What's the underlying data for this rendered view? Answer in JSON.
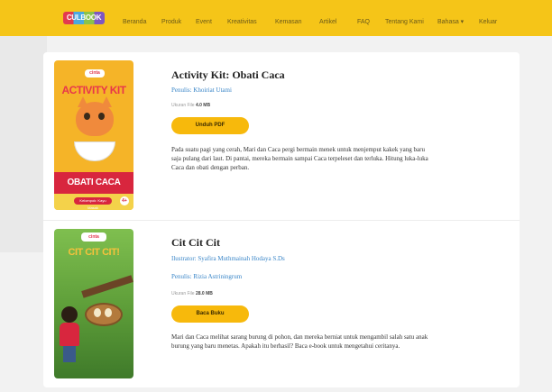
{
  "colors": {
    "nav_bg": "#f5c518",
    "accent_button": "#f7b90c",
    "link_blue": "#3a86c8",
    "page_bg": "#f2f2f2"
  },
  "nav": {
    "logo_text": "CULBOOK",
    "items": [
      "Beranda",
      "Produk",
      "Event",
      "Kreativitas",
      "Kemasan",
      "Artikel",
      "FAQ",
      "Tentang Kami",
      "Bahasa ▾",
      "Keluar"
    ]
  },
  "books": [
    {
      "title": "Activity Kit: Obati Caca",
      "author_line": "Penulis: Khoiriat Utami",
      "filesize_label": "Ukuran File",
      "filesize_value": "4.0 MB",
      "button_label": "Unduh PDF",
      "description": "Pada suatu pagi yang cerah, Mari dan Caca pergi bermain menek untuk menjemput kakek yang baru saja pulang dari laut. Di pantai, mereka bermain sampai Caca terpeleset dan terluka. Hitung luka-luka Caca dan obati dengan perban.",
      "cover": {
        "logo": "cinta",
        "title": "ACTIVITY KIT",
        "banner": "OBATI CACA",
        "footer_pill": "Kelompok: Kayu Masak",
        "age_badge": "4+"
      }
    },
    {
      "title": "Cit Cit Cit",
      "illustrator_line": "Ilustrator: Syafira Muthmainah Hodaya S.Ds",
      "author_line": "Penulis: Rizia Astriningrum",
      "filesize_label": "Ukuran File",
      "filesize_value": "28.0 MB",
      "button_label": "Baca Buku",
      "description": "Mari dan Caca melihat sarang burung di pohon, dan mereka berniat untuk mengambil salah satu anak burung yang baru menetas. Apakah itu berhasil? Baca e-book untuk mengetahui ceritanya.",
      "cover": {
        "logo": "cinta",
        "title": "CIT CIT CIT!"
      }
    }
  ]
}
